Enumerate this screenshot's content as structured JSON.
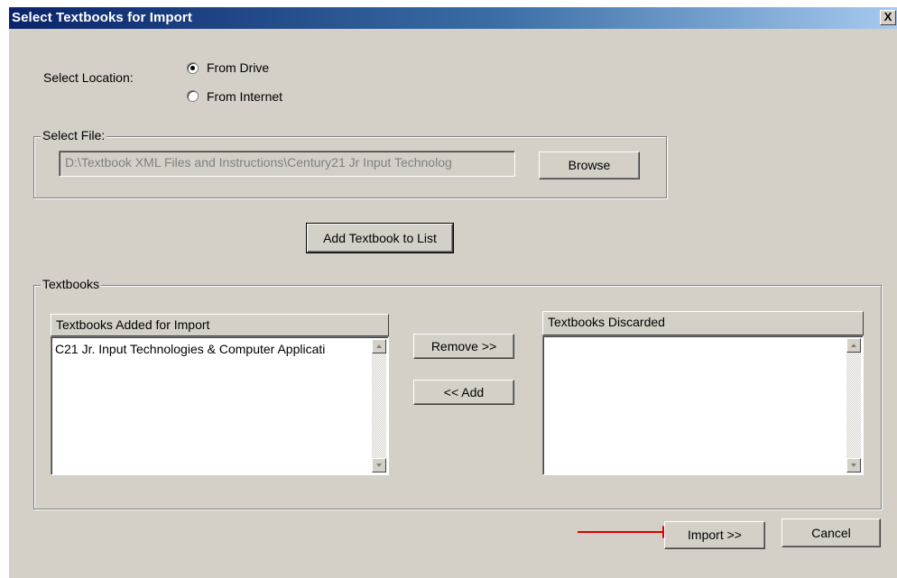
{
  "window": {
    "title": "Select Textbooks for Import",
    "close_glyph": "X"
  },
  "location": {
    "label": "Select Location:",
    "options": [
      {
        "label": "From Drive",
        "checked": true
      },
      {
        "label": "From Internet",
        "checked": false
      }
    ]
  },
  "file": {
    "group_label": "Select File:",
    "path_value": "D:\\Textbook XML Files and Instructions\\Century21 Jr Input Technolog",
    "browse_label": "Browse"
  },
  "add_to_list_label": "Add Textbook to List",
  "textbooks": {
    "group_label": "Textbooks",
    "added_header": "Textbooks Added for Import",
    "added_items": [
      "C21 Jr. Input Technologies & Computer Applicati"
    ],
    "discarded_header": "Textbooks Discarded",
    "discarded_items": [],
    "remove_label": "Remove >>",
    "add_label": "<< Add"
  },
  "footer": {
    "import_label": "Import >>",
    "cancel_label": "Cancel"
  },
  "colors": {
    "dialog_bg": "#d4d0c8",
    "title_start": "#0a246a",
    "title_end": "#a6caf0",
    "annotation_arrow": "#e00000"
  },
  "icons": {
    "close": "close-icon",
    "arrow": "red-pointer-arrow-icon"
  }
}
